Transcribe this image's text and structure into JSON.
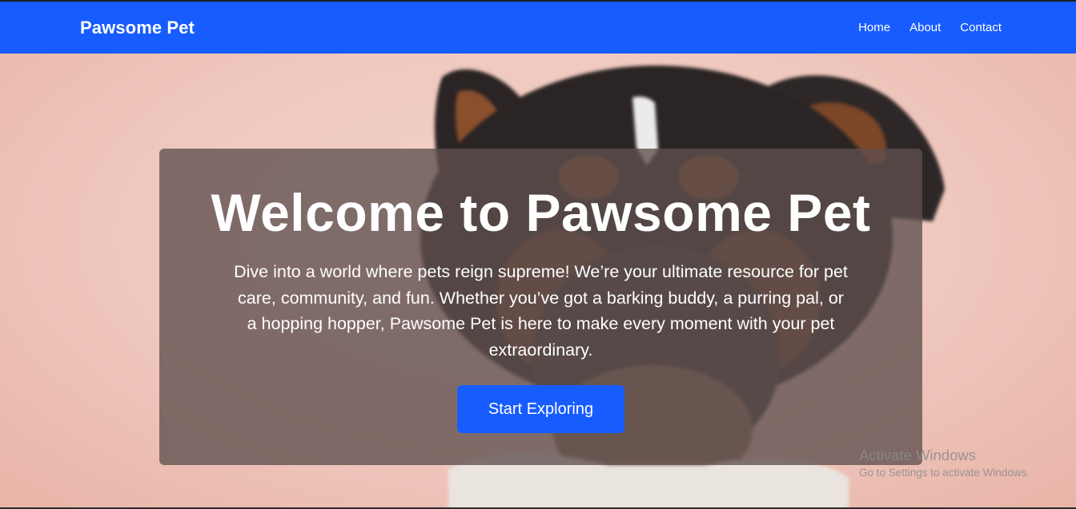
{
  "navbar": {
    "brand": "Pawsome Pet",
    "links": [
      {
        "label": "Home"
      },
      {
        "label": "About"
      },
      {
        "label": "Contact"
      }
    ]
  },
  "hero": {
    "title": "Welcome to Pawsome Pet",
    "description": "Dive into a world where pets reign supreme! We’re your ultimate resource for pet care, community, and fun. Whether you’ve got a barking buddy, a purring pal, or a hopping hopper, Pawsome Pet is here to make every moment with your pet extraordinary.",
    "cta_label": "Start Exploring"
  },
  "watermark": {
    "title": "Activate Windows",
    "subtitle": "Go to Settings to activate Windows."
  },
  "colors": {
    "primary": "#175cff",
    "card_overlay": "rgba(95,80,78,0.78)",
    "background": "#f0c9c0"
  }
}
